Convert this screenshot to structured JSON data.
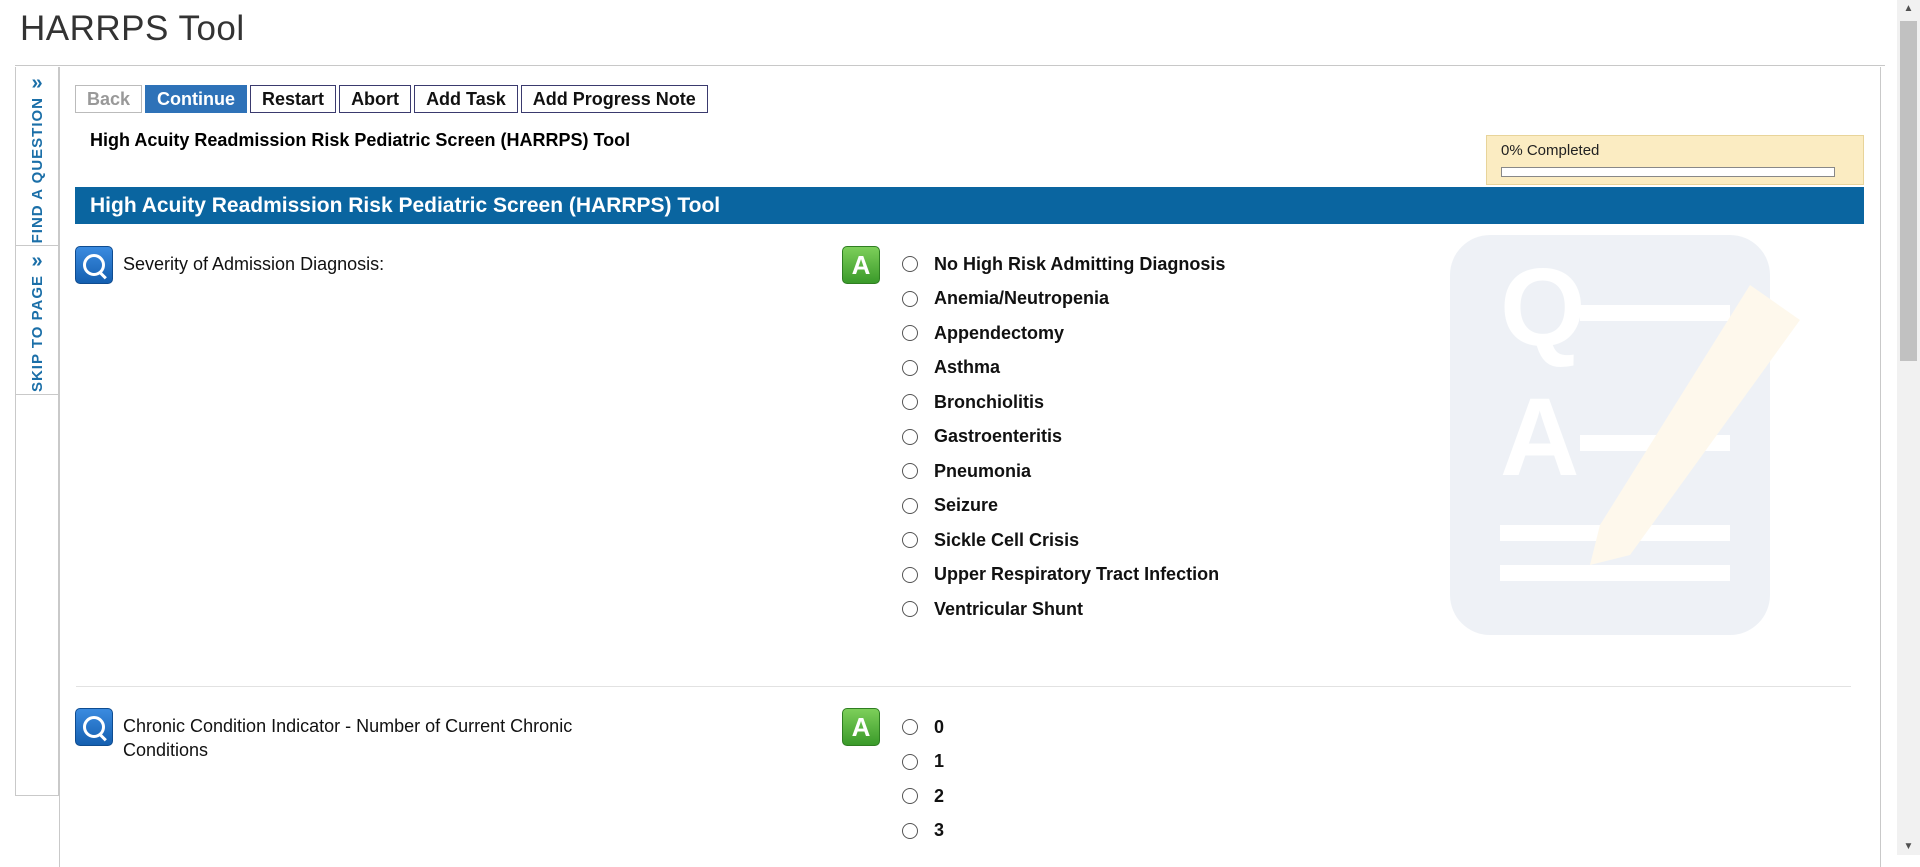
{
  "app": {
    "title": "HARRPS Tool"
  },
  "side_tabs": {
    "find": {
      "label": "FIND A QUESTION",
      "icon": "double-chevron-right-icon"
    },
    "skip": {
      "label": "SKIP TO PAGE",
      "icon": "double-chevron-right-icon"
    }
  },
  "toolbar": {
    "back": "Back",
    "continue": "Continue",
    "restart": "Restart",
    "abort": "Abort",
    "add_task": "Add Task",
    "add_progress_note": "Add Progress Note"
  },
  "form": {
    "title": "High Acuity Readmission Risk Pediatric Screen (HARRPS) Tool",
    "section_title": "High Acuity Readmission Risk Pediatric Screen (HARRPS) Tool"
  },
  "progress": {
    "label": "0% Completed",
    "percent": 0
  },
  "questions": [
    {
      "text": "Severity of Admission Diagnosis:",
      "answer_icon": "A",
      "options": [
        "No High Risk Admitting Diagnosis",
        "Anemia/Neutropenia",
        "Appendectomy",
        "Asthma",
        "Bronchiolitis",
        "Gastroenteritis",
        "Pneumonia",
        "Seizure",
        "Sickle Cell Crisis",
        "Upper Respiratory Tract Infection",
        "Ventricular Shunt"
      ]
    },
    {
      "text_line1": "Chronic Condition Indicator - Number of Current Chronic",
      "text_line2": "Conditions",
      "answer_icon": "A",
      "options": [
        "0",
        "1",
        "2",
        "3"
      ]
    }
  ],
  "colors": {
    "primary": "#2e72b8",
    "section_bar": "#0a65a0",
    "progress_bg": "#fbecc2",
    "side_tab_text": "#1b6fa8"
  }
}
